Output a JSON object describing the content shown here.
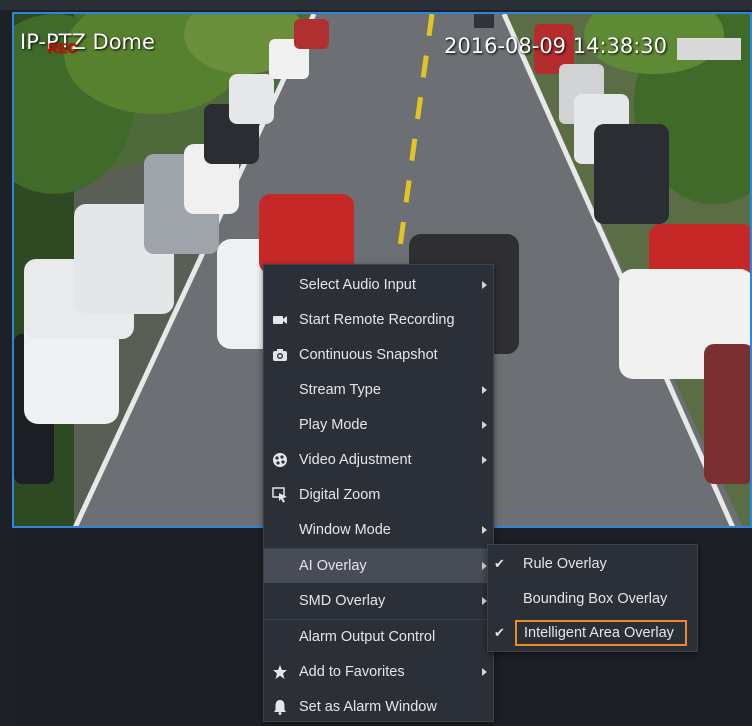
{
  "video": {
    "camera_name": "IP-PTZ Dome",
    "rec_badge": "REC",
    "timestamp": "2016-08-09 14:38:30"
  },
  "context_menu": {
    "items": [
      {
        "label": "Select Audio Input",
        "icon": "",
        "submenu": true
      },
      {
        "label": "Start Remote Recording",
        "icon": "video-camera-icon",
        "submenu": false
      },
      {
        "label": "Continuous Snapshot",
        "icon": "camera-icon",
        "submenu": false
      },
      {
        "label": "Stream Type",
        "icon": "",
        "submenu": true
      },
      {
        "label": "Play Mode",
        "icon": "",
        "submenu": true
      },
      {
        "label": "Video Adjustment",
        "icon": "palette-icon",
        "submenu": true
      },
      {
        "label": "Digital Zoom",
        "icon": "zoom-cursor-icon",
        "submenu": false
      },
      {
        "label": "Window Mode",
        "icon": "",
        "submenu": true
      },
      {
        "label": "AI Overlay",
        "icon": "",
        "submenu": true,
        "active": true
      },
      {
        "label": "SMD Overlay",
        "icon": "",
        "submenu": true
      },
      {
        "label": "Alarm Output Control",
        "icon": "",
        "submenu": false
      },
      {
        "label": "Add to Favorites",
        "icon": "star-icon",
        "submenu": true
      },
      {
        "label": "Set as Alarm Window",
        "icon": "bell-icon",
        "submenu": false
      }
    ]
  },
  "ai_overlay_submenu": {
    "items": [
      {
        "label": "Rule Overlay",
        "checked": true
      },
      {
        "label": "Bounding Box Overlay",
        "checked": false
      },
      {
        "label": "Intelligent Area Overlay",
        "checked": true,
        "highlighted": true
      }
    ]
  },
  "colors": {
    "selection_border": "#2f86d6",
    "menu_background": "#2b2f37",
    "highlight": "#f08a24",
    "rec": "#e60000"
  }
}
